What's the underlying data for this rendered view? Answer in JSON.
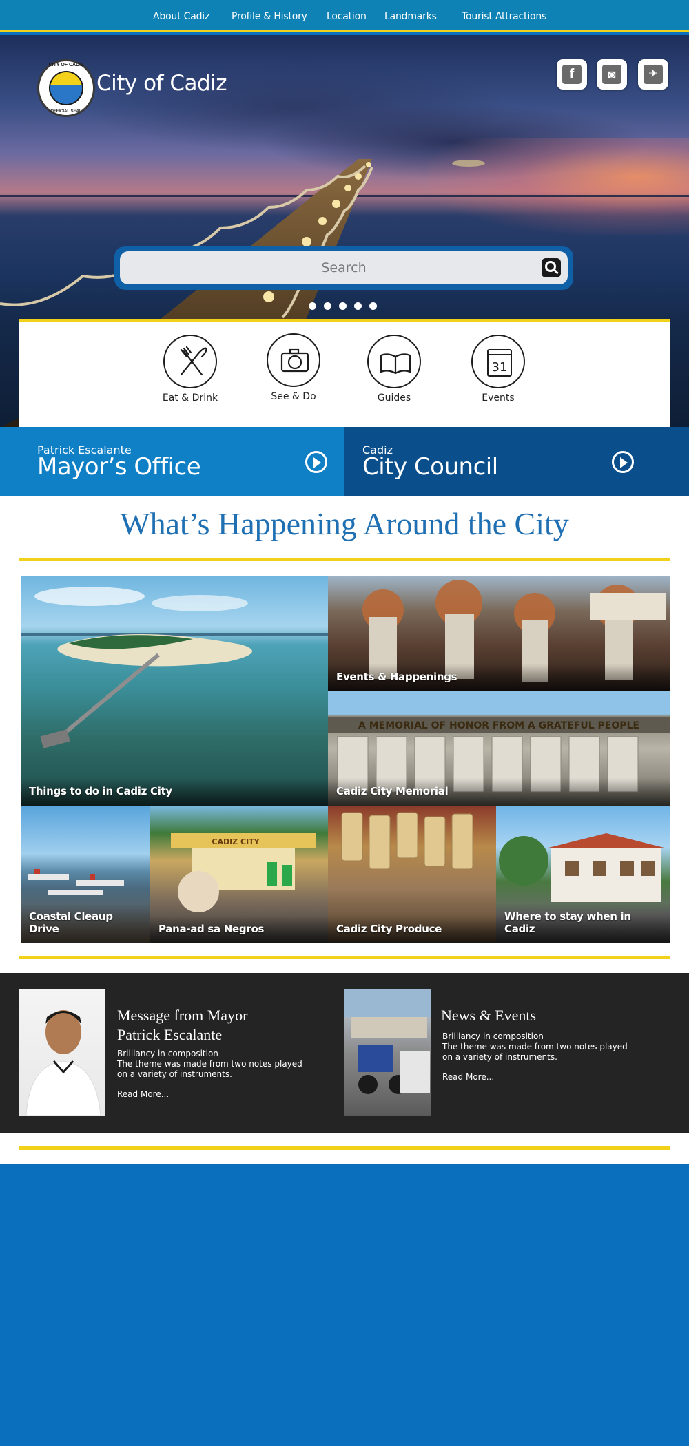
{
  "nav": {
    "items": [
      {
        "label": "About Cadiz"
      },
      {
        "label": "Profile & History"
      },
      {
        "label": "Location"
      },
      {
        "label": "Landmarks"
      },
      {
        "label": "Tourist Attractions"
      }
    ]
  },
  "header": {
    "site_title": "City of Cadiz",
    "seal_top": "CITY OF CADIZ",
    "seal_bottom": "OFFICIAL SEAL",
    "social": [
      {
        "name": "facebook",
        "glyph": "f"
      },
      {
        "name": "instagram",
        "glyph": "◙"
      },
      {
        "name": "twitter",
        "glyph": "✈"
      }
    ]
  },
  "search": {
    "placeholder": "Search"
  },
  "slider": {
    "dot_count": 5
  },
  "quick_links": [
    {
      "label": "Eat & Drink",
      "icon": "fork-knife-icon"
    },
    {
      "label": "See & Do",
      "icon": "camera-icon"
    },
    {
      "label": "Guides",
      "icon": "book-icon"
    },
    {
      "label": "Events",
      "icon": "calendar-icon",
      "calendar_day": "31"
    }
  ],
  "offices": [
    {
      "sub": "Patrick Escalante",
      "main": "Mayor’s Office",
      "color": "#0f7fc6"
    },
    {
      "sub": "Cadiz",
      "main": "City Council",
      "color": "#0a4f8c"
    }
  ],
  "happening": {
    "title": "What’s Happening Around the City",
    "tiles": [
      {
        "caption": "Things to do in Cadiz City"
      },
      {
        "caption": "Events & Happenings"
      },
      {
        "caption": "Cadiz City Memorial",
        "sign_text": "A MEMORIAL OF HONOR FROM A GRATEFUL PEOPLE"
      },
      {
        "caption": "Coastal Cleaup Drive"
      },
      {
        "caption": "Pana-ad sa Negros",
        "sign_text": "CADIZ CITY"
      },
      {
        "caption": "Cadiz City Produce"
      },
      {
        "caption": "Where to stay when in Cadiz"
      }
    ]
  },
  "features": [
    {
      "title": "Message from Mayor\nPatrick Escalante",
      "text": "Brilliancy in composition\nThe theme was made from two notes played\non a variety of instruments.",
      "more": "Read More..."
    },
    {
      "title": "News & Events",
      "text": "Brilliancy in composition\nThe theme was made from two notes played\non a variety of instruments.",
      "more": "Read More..."
    }
  ],
  "colors": {
    "accent_yellow": "#f2d11b",
    "nav_blue": "#0f82b5",
    "title_blue": "#1f6fb3",
    "dark_bg": "#242424",
    "bottom_blue": "#0a6fbd"
  }
}
